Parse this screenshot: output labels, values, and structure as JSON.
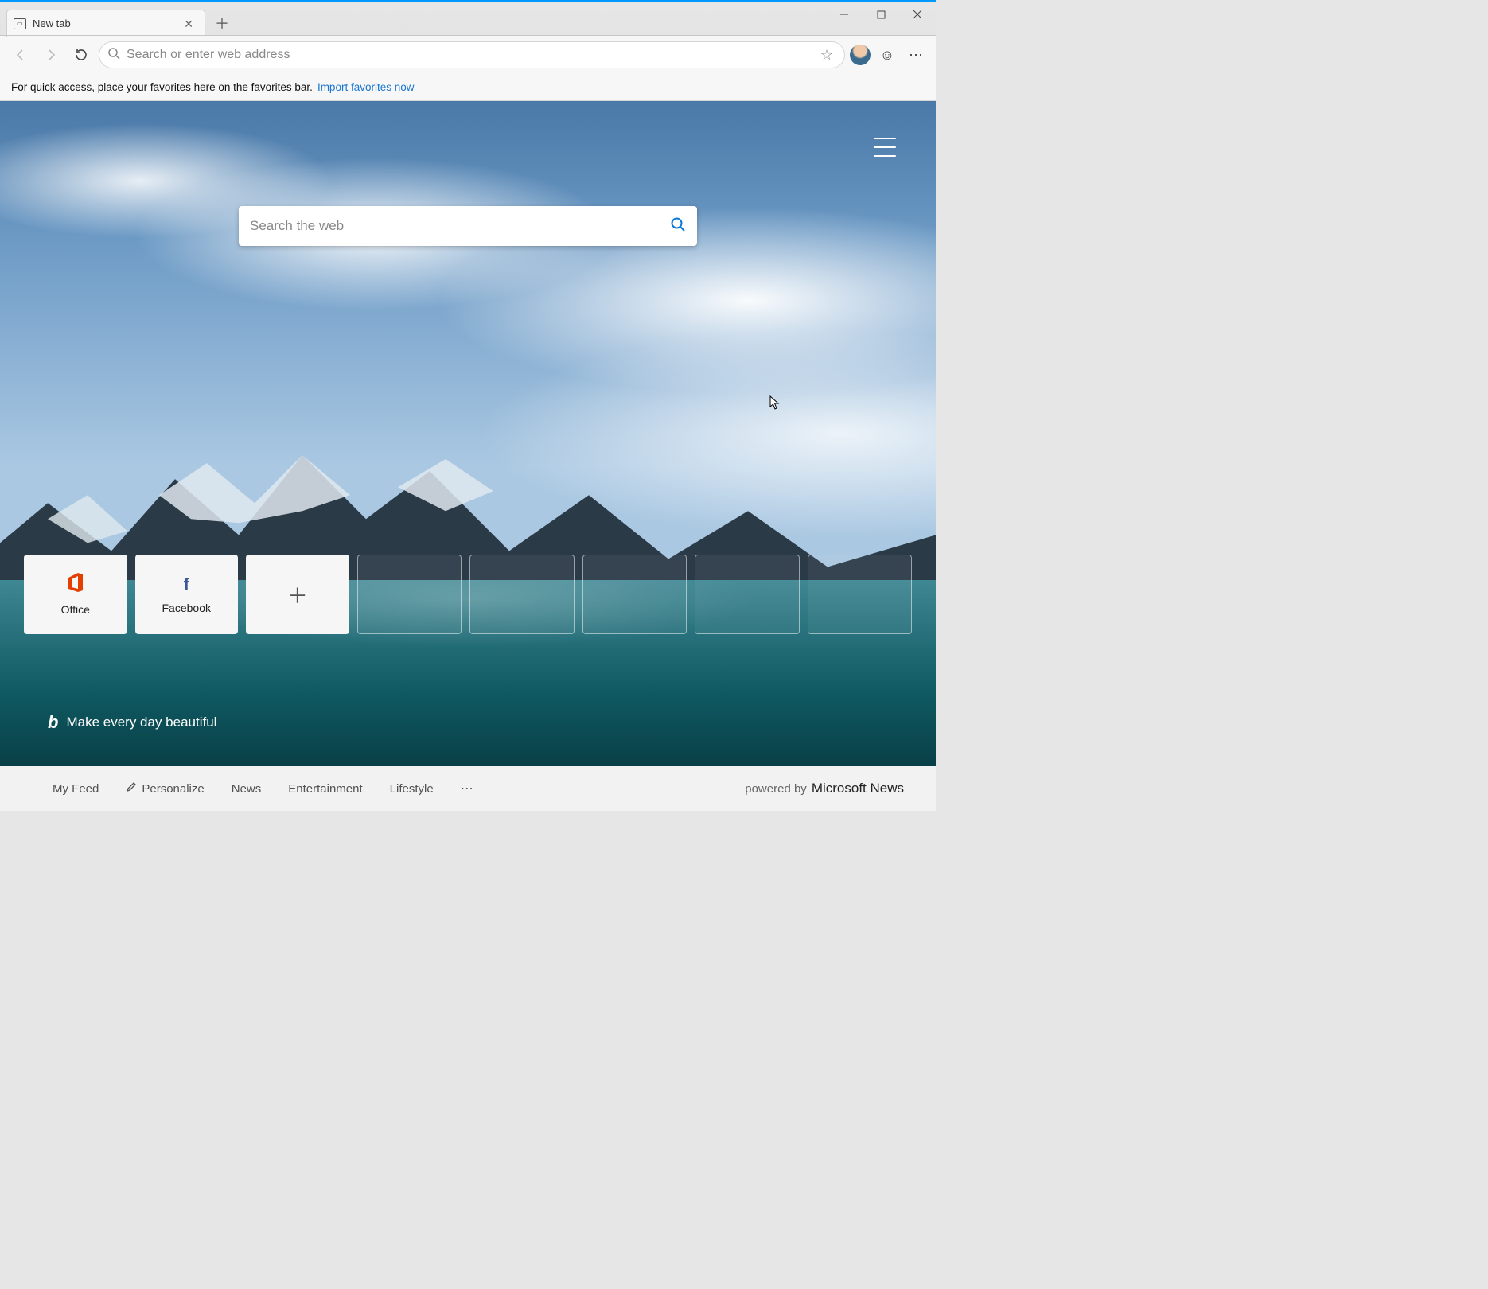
{
  "window": {
    "tab_title": "New tab"
  },
  "toolbar": {
    "address_placeholder": "Search or enter web address"
  },
  "favorites_bar": {
    "text": "For quick access, place your favorites here on the favorites bar.",
    "link": "Import favorites now"
  },
  "page": {
    "search_placeholder": "Search the web",
    "tiles": [
      {
        "label": "Office",
        "icon": "office"
      },
      {
        "label": "Facebook",
        "icon": "facebook"
      }
    ],
    "tagline": "Make every day beautiful"
  },
  "bottom_nav": {
    "items": [
      "My Feed",
      "Personalize",
      "News",
      "Entertainment",
      "Lifestyle"
    ],
    "powered_prefix": "powered by",
    "powered_brand": "Microsoft News"
  }
}
